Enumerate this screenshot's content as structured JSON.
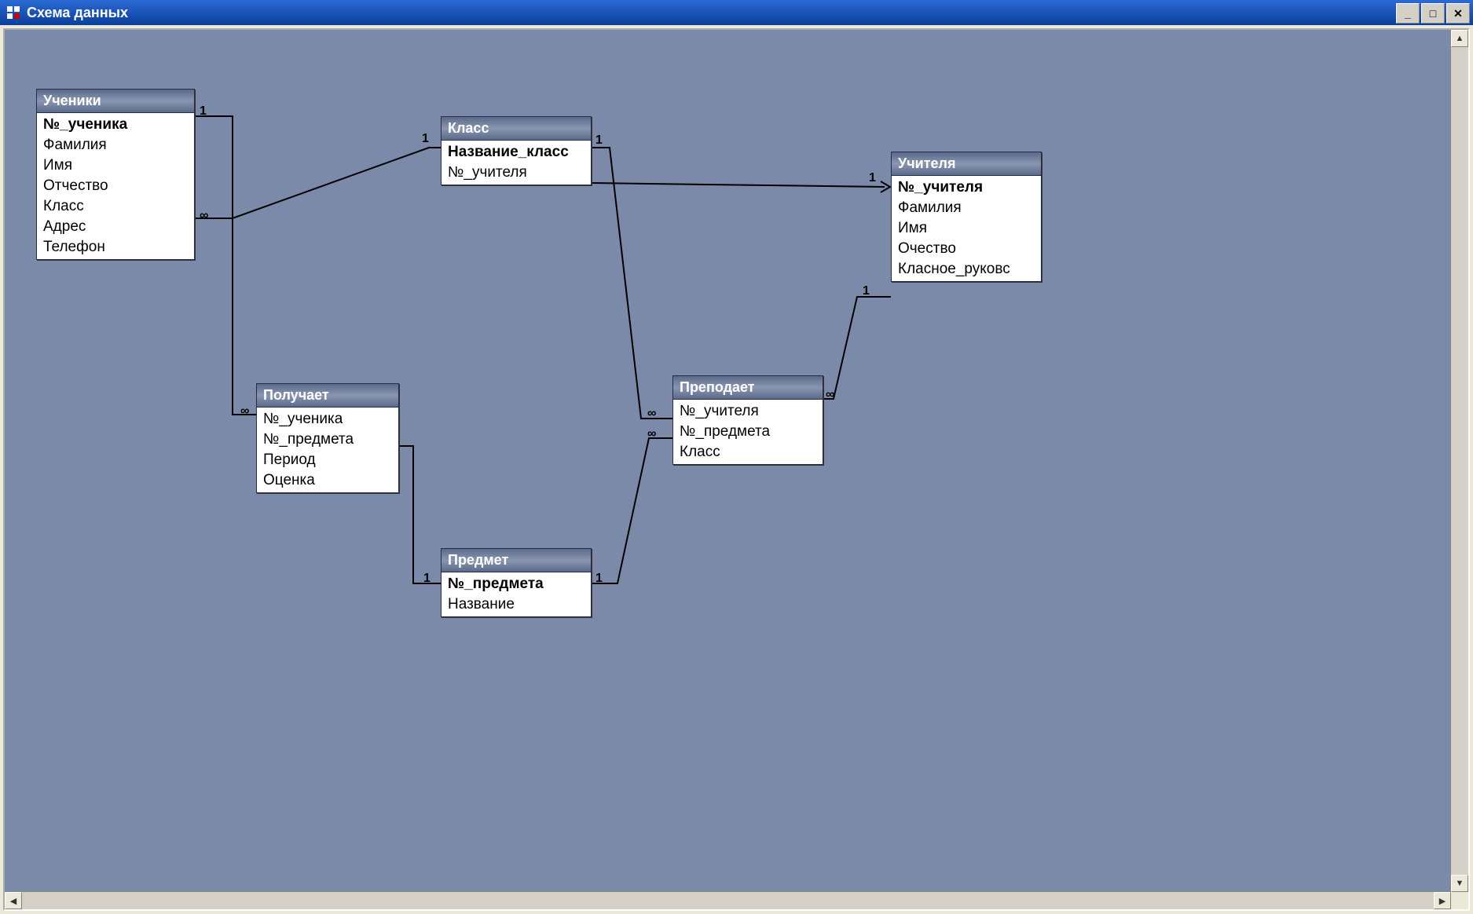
{
  "window": {
    "title": "Схема данных",
    "buttons": {
      "min": "_",
      "max": "□",
      "close": "✕"
    }
  },
  "tables": {
    "students": {
      "title": "Ученики",
      "fields": [
        "№_ученика",
        "Фамилия",
        "Имя",
        "Отчество",
        "Класс",
        "Адрес",
        "Телефон"
      ],
      "pk_index": 0
    },
    "class": {
      "title": "Класс",
      "fields": [
        "Название_класс",
        "№_учителя"
      ],
      "pk_index": 0
    },
    "teachers": {
      "title": "Учителя",
      "fields": [
        "№_учителя",
        "Фамилия",
        "Имя",
        "Очество",
        "Класное_руковс"
      ],
      "pk_index": 0
    },
    "receives": {
      "title": "Получает",
      "fields": [
        "№_ученика",
        "№_предмета",
        "Период",
        "Оценка"
      ],
      "pk_index": -1
    },
    "subject": {
      "title": "Предмет",
      "fields": [
        "№_предмета",
        "Название"
      ],
      "pk_index": 0
    },
    "teaches": {
      "title": "Преподает",
      "fields": [
        "№_учителя",
        "№_предмета",
        "Класс"
      ],
      "pk_index": -1
    }
  },
  "relations": [
    {
      "from": "students",
      "to": "receives",
      "from_card": "1",
      "to_card": "∞"
    },
    {
      "from": "students",
      "to": "class",
      "from_card": "∞",
      "to_card": "1"
    },
    {
      "from": "class",
      "to": "teachers",
      "from_card": "1",
      "to_card": "1"
    },
    {
      "from": "class",
      "to": "teaches",
      "from_card": "1",
      "to_card": "∞"
    },
    {
      "from": "subject",
      "to": "receives",
      "from_card": "1",
      "to_card": "∞"
    },
    {
      "from": "subject",
      "to": "teaches",
      "from_card": "1",
      "to_card": "∞"
    },
    {
      "from": "teachers",
      "to": "teaches",
      "from_card": "1",
      "to_card": "∞"
    }
  ],
  "scroll": {
    "up": "▲",
    "down": "▼",
    "left": "◀",
    "right": "▶"
  }
}
